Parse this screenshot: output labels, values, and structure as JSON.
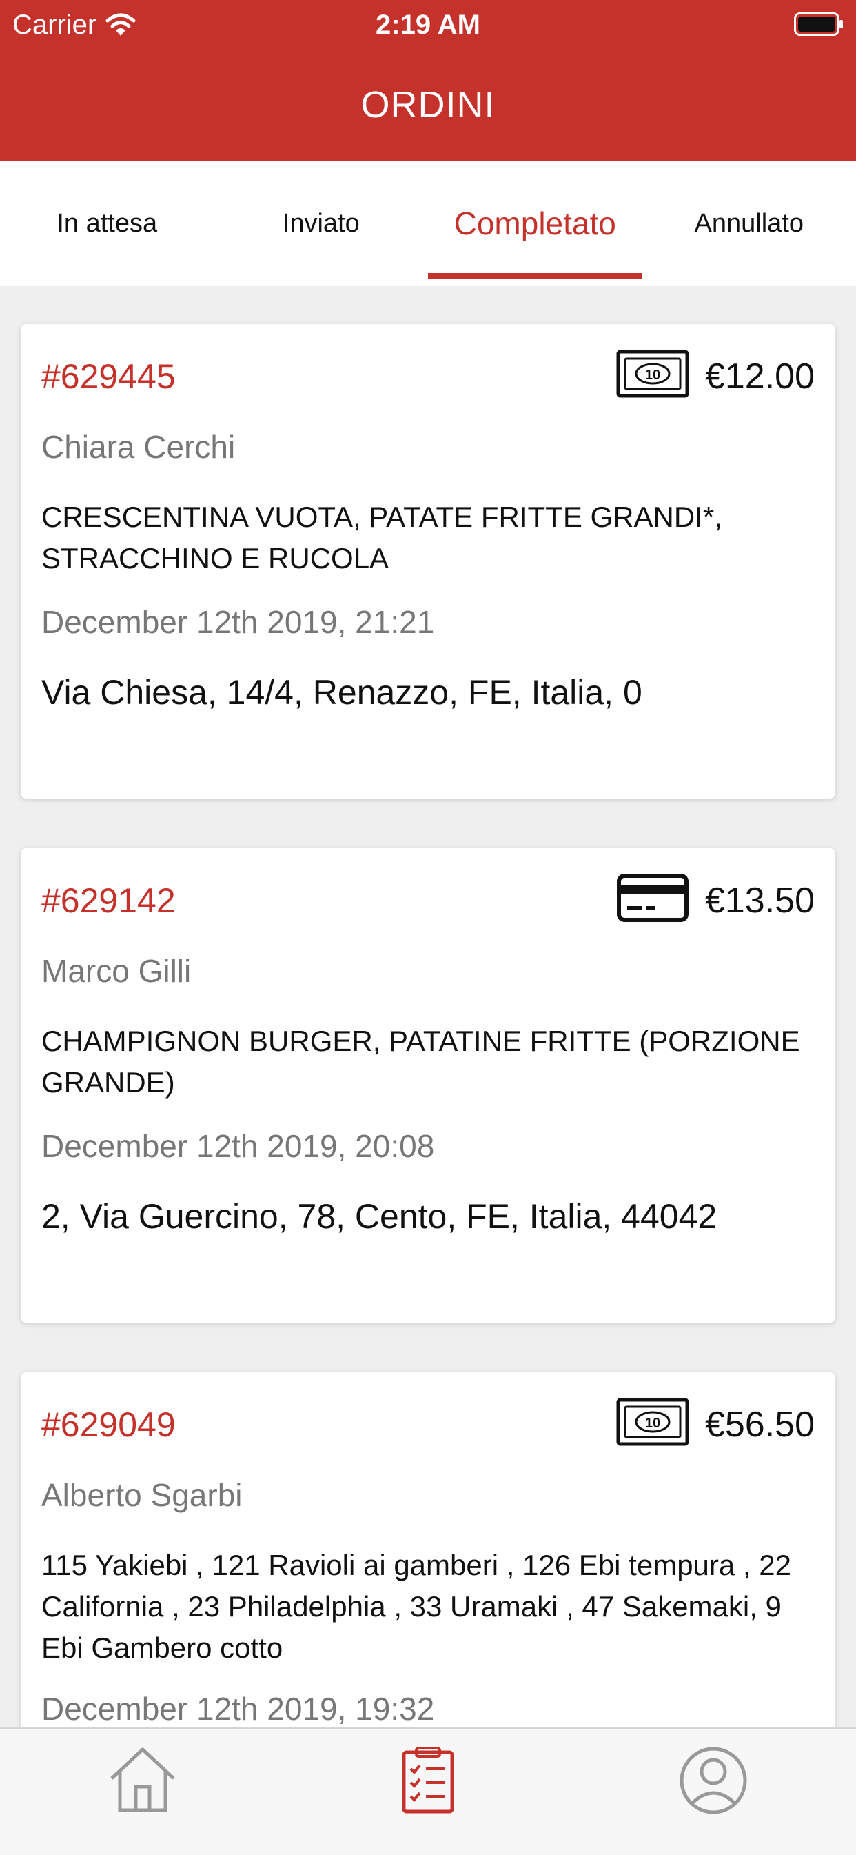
{
  "status_bar": {
    "carrier": "Carrier",
    "time": "2:19 AM"
  },
  "header": {
    "title": "ORDINI"
  },
  "colors": {
    "primary": "#c5322b",
    "muted": "#777777"
  },
  "tabs": [
    {
      "label": "In attesa",
      "active": false
    },
    {
      "label": "Inviato",
      "active": false
    },
    {
      "label": "Completato",
      "active": true
    },
    {
      "label": "Annullato",
      "active": false
    }
  ],
  "orders": [
    {
      "id": "#629445",
      "payment_icon": "cash-icon",
      "price": "€12.00",
      "customer": "Chiara Cerchi",
      "items": "CRESCENTINA VUOTA, PATATE FRITTE GRANDI*, STRACCHINO E RUCOLA",
      "date": "December 12th 2019, 21:21",
      "address": "Via Chiesa, 14/4, Renazzo, FE, Italia, 0"
    },
    {
      "id": "#629142",
      "payment_icon": "credit-card-icon",
      "price": "€13.50",
      "customer": "Marco Gilli",
      "items": "CHAMPIGNON BURGER, PATATINE FRITTE (PORZIONE GRANDE)",
      "date": "December 12th 2019, 20:08",
      "address": "2, Via Guercino, 78, Cento, FE, Italia, 44042"
    },
    {
      "id": "#629049",
      "payment_icon": "cash-icon",
      "price": "€56.50",
      "customer": "Alberto Sgarbi",
      "items": "115 Yakiebi , 121 Ravioli ai gamberi , 126 Ebi tempura , 22 California , 23 Philadelphia , 33 Uramaki , 47 Sakemaki, 9 Ebi Gambero cotto",
      "date": "December 12th 2019, 19:32"
    }
  ],
  "bottom_nav": [
    {
      "icon": "home-icon",
      "active": false
    },
    {
      "icon": "orders-list-icon",
      "active": true
    },
    {
      "icon": "profile-icon",
      "active": false
    }
  ]
}
